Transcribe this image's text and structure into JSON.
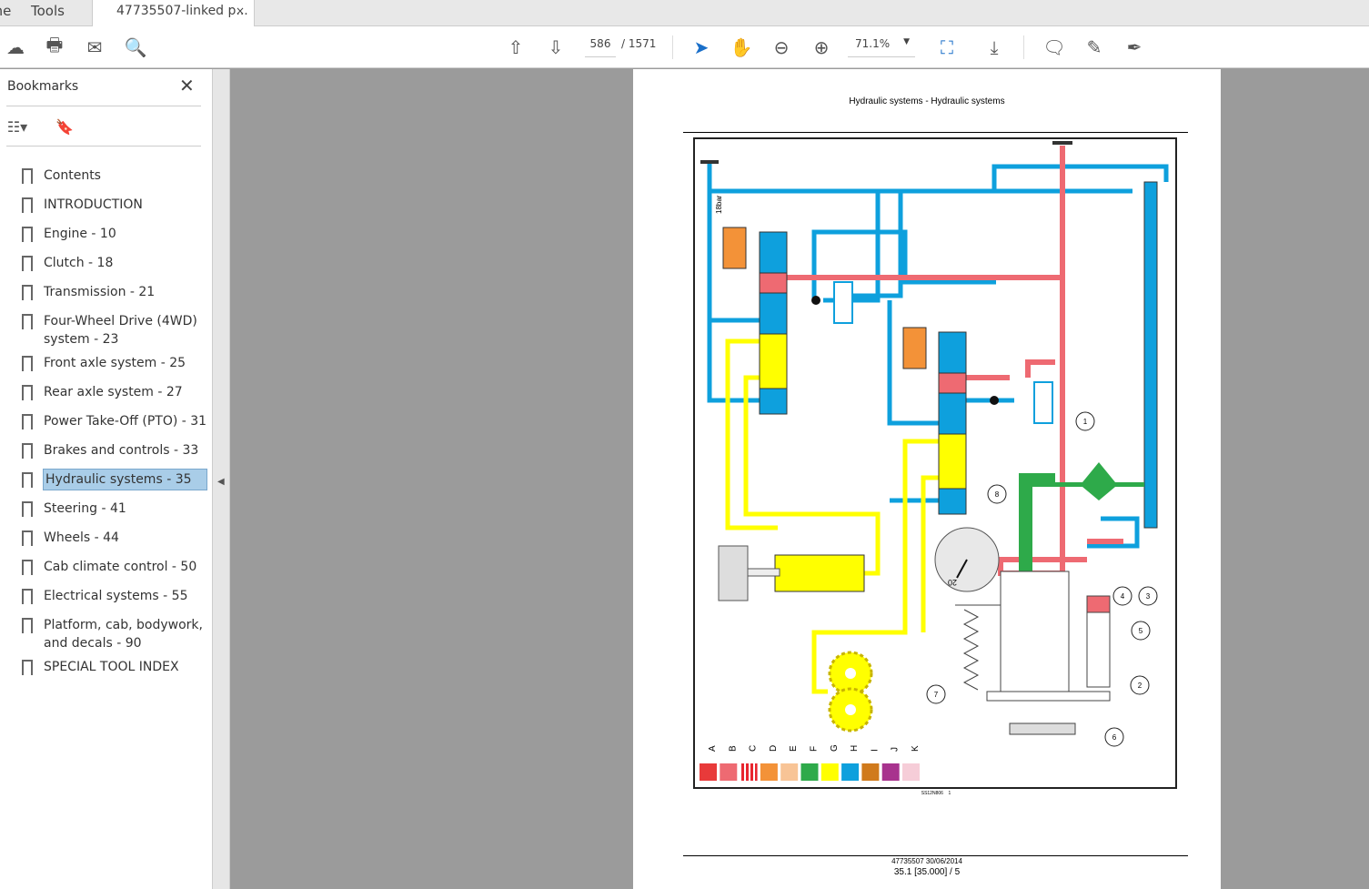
{
  "tabs": {
    "home": "Home",
    "tools": "Tools",
    "document": "47735507-linked p...",
    "close": "×"
  },
  "toolbar": {
    "page_current": "586",
    "page_total": "/ 1571",
    "zoom": "71.1%"
  },
  "sidebar": {
    "title": "Bookmarks",
    "close": "✕",
    "items": [
      {
        "label": "Contents"
      },
      {
        "label": "INTRODUCTION"
      },
      {
        "label": "Engine - 10"
      },
      {
        "label": "Clutch - 18"
      },
      {
        "label": "Transmission - 21"
      },
      {
        "label": "Four-Wheel Drive (4WD) system - 23"
      },
      {
        "label": "Front axle system - 25"
      },
      {
        "label": "Rear axle system - 27"
      },
      {
        "label": "Power Take-Off (PTO) - 31"
      },
      {
        "label": "Brakes and controls - 33"
      },
      {
        "label": "Hydraulic systems - 35",
        "selected": true
      },
      {
        "label": "Steering - 41"
      },
      {
        "label": "Wheels - 44"
      },
      {
        "label": "Cab climate control - 50"
      },
      {
        "label": "Electrical systems - 55"
      },
      {
        "label": "Platform, cab, bodywork, and decals - 90"
      },
      {
        "label": "SPECIAL TOOL INDEX"
      }
    ]
  },
  "page": {
    "header": "Hydraulic systems - Hydraulic systems",
    "figure_ref": "SS12N806",
    "figure_num": "1",
    "footer_doc": "47735507 30/06/2014",
    "footer_page": "35.1 [35.000] / 5",
    "diagram": {
      "pressure_label": "18bar",
      "gauge_label": "20",
      "callouts": [
        "1",
        "2",
        "3",
        "4",
        "5",
        "6",
        "7",
        "8"
      ],
      "legend": [
        {
          "key": "A",
          "color": "#e83a3a"
        },
        {
          "key": "B",
          "color": "#ee6a72"
        },
        {
          "key": "C",
          "color": "#e8262f"
        },
        {
          "key": "D",
          "color": "#f39238"
        },
        {
          "key": "E",
          "color": "#f8c496"
        },
        {
          "key": "F",
          "color": "#2eaa4a"
        },
        {
          "key": "G",
          "color": "#ffff00"
        },
        {
          "key": "H",
          "color": "#0ea0dd"
        },
        {
          "key": "I",
          "color": "#d07a1c"
        },
        {
          "key": "J",
          "color": "#a8338e"
        },
        {
          "key": "K",
          "color": "#f6cdd8"
        }
      ]
    }
  }
}
